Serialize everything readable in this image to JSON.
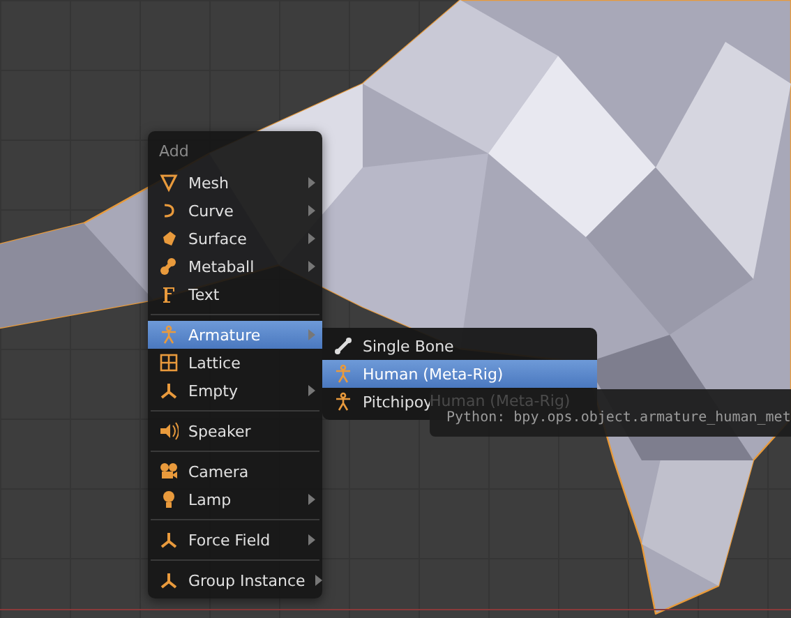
{
  "menu": {
    "title": "Add",
    "groups": [
      [
        {
          "label": "Mesh",
          "has_submenu": true,
          "selected": false
        },
        {
          "label": "Curve",
          "has_submenu": true,
          "selected": false
        },
        {
          "label": "Surface",
          "has_submenu": true,
          "selected": false
        },
        {
          "label": "Metaball",
          "has_submenu": true,
          "selected": false
        },
        {
          "label": "Text",
          "has_submenu": false,
          "selected": false
        }
      ],
      [
        {
          "label": "Armature",
          "has_submenu": true,
          "selected": true
        },
        {
          "label": "Lattice",
          "has_submenu": false,
          "selected": false
        },
        {
          "label": "Empty",
          "has_submenu": true,
          "selected": false
        }
      ],
      [
        {
          "label": "Speaker",
          "has_submenu": false,
          "selected": false
        }
      ],
      [
        {
          "label": "Camera",
          "has_submenu": false,
          "selected": false
        },
        {
          "label": "Lamp",
          "has_submenu": true,
          "selected": false
        }
      ],
      [
        {
          "label": "Force Field",
          "has_submenu": true,
          "selected": false
        }
      ],
      [
        {
          "label": "Group Instance",
          "has_submenu": true,
          "selected": false
        }
      ]
    ]
  },
  "submenu": {
    "items": [
      {
        "label": "Single Bone",
        "selected": false
      },
      {
        "label": "Human (Meta-Rig)",
        "selected": true
      },
      {
        "label": "Pitchipoy",
        "selected": false
      }
    ]
  },
  "tooltip": {
    "title": "Human (Meta-Rig)",
    "python": "Python: bpy.ops.object.armature_human_met"
  }
}
